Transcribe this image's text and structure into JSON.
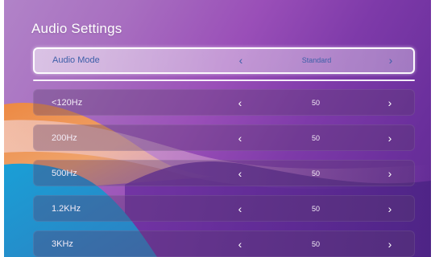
{
  "title": "Audio Settings",
  "audio_mode": {
    "label": "Audio Mode",
    "value": "Standard"
  },
  "arrows": {
    "left": "‹",
    "right": "›"
  },
  "bands": [
    {
      "label": "<120Hz",
      "value": "50"
    },
    {
      "label": "200Hz",
      "value": "50"
    },
    {
      "label": "500Hz",
      "value": "50"
    },
    {
      "label": "1.2KHz",
      "value": "50"
    },
    {
      "label": "3KHz",
      "value": "50"
    }
  ],
  "colors": {
    "selected_text": "#3d5fa8",
    "text": "#f3ecf7"
  }
}
